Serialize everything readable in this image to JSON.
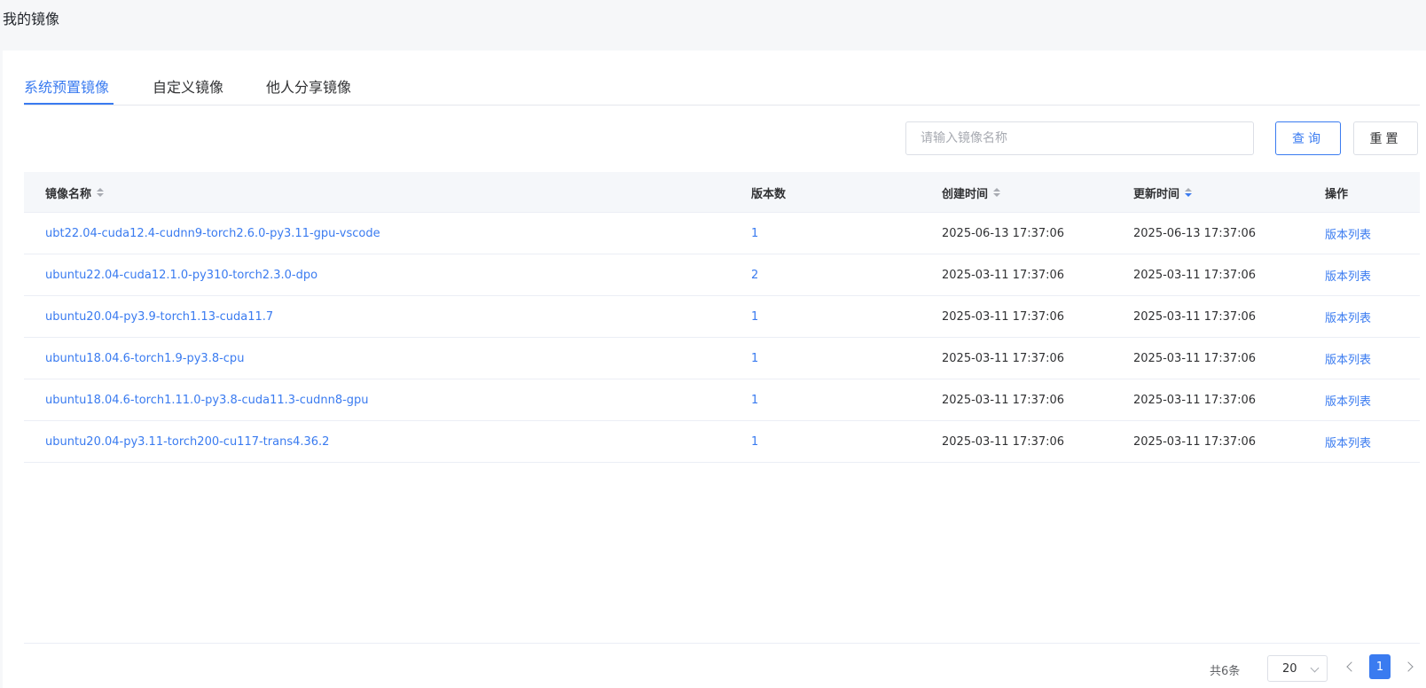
{
  "page": {
    "title": "我的镜像"
  },
  "tabs": [
    {
      "label": "系统预置镜像",
      "active": true
    },
    {
      "label": "自定义镜像",
      "active": false
    },
    {
      "label": "他人分享镜像",
      "active": false
    }
  ],
  "search": {
    "placeholder": "请输入镜像名称",
    "value": ""
  },
  "buttons": {
    "query": "查询",
    "reset": "重置"
  },
  "table": {
    "columns": [
      {
        "label": "镜像名称",
        "sortable": true
      },
      {
        "label": "版本数",
        "sortable": false
      },
      {
        "label": "创建时间",
        "sortable": true
      },
      {
        "label": "更新时间",
        "sortable": true,
        "sort": "desc"
      },
      {
        "label": "操作",
        "sortable": false
      }
    ],
    "rows": [
      {
        "name": "ubt22.04-cuda12.4-cudnn9-torch2.6.0-py3.11-gpu-vscode",
        "versions": "1",
        "created": "2025-06-13 17:37:06",
        "updated": "2025-06-13 17:37:06",
        "action": "版本列表"
      },
      {
        "name": "ubuntu22.04-cuda12.1.0-py310-torch2.3.0-dpo",
        "versions": "2",
        "created": "2025-03-11 17:37:06",
        "updated": "2025-03-11 17:37:06",
        "action": "版本列表"
      },
      {
        "name": "ubuntu20.04-py3.9-torch1.13-cuda11.7",
        "versions": "1",
        "created": "2025-03-11 17:37:06",
        "updated": "2025-03-11 17:37:06",
        "action": "版本列表"
      },
      {
        "name": "ubuntu18.04.6-torch1.9-py3.8-cpu",
        "versions": "1",
        "created": "2025-03-11 17:37:06",
        "updated": "2025-03-11 17:37:06",
        "action": "版本列表"
      },
      {
        "name": "ubuntu18.04.6-torch1.11.0-py3.8-cuda11.3-cudnn8-gpu",
        "versions": "1",
        "created": "2025-03-11 17:37:06",
        "updated": "2025-03-11 17:37:06",
        "action": "版本列表"
      },
      {
        "name": "ubuntu20.04-py3.11-torch200-cu117-trans4.36.2",
        "versions": "1",
        "created": "2025-03-11 17:37:06",
        "updated": "2025-03-11 17:37:06",
        "action": "版本列表"
      }
    ]
  },
  "pagination": {
    "total_text": "共6条",
    "page_size": "20",
    "current_page": "1"
  },
  "colors": {
    "accent": "#3a7bf0",
    "text": "#303133",
    "border": "#ebeef5",
    "header_bg": "#f5f7fa"
  }
}
